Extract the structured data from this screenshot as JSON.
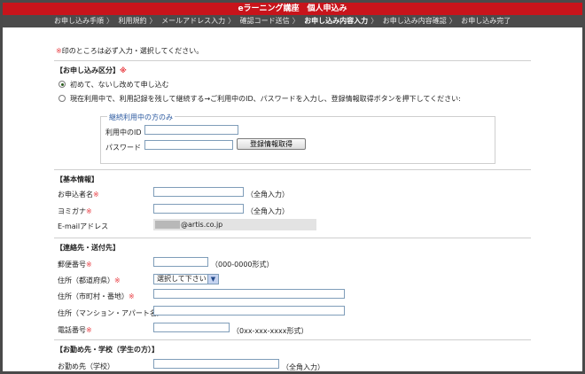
{
  "title": "eラーニング講座　個人申込み",
  "steps": [
    {
      "label": "お申し込み手順",
      "current": false
    },
    {
      "label": "利用規約",
      "current": false
    },
    {
      "label": "メールアドレス入力",
      "current": false
    },
    {
      "label": "確認コード送信",
      "current": false
    },
    {
      "label": "お申し込み内容入力",
      "current": true
    },
    {
      "label": "お申し込み内容確認",
      "current": false
    },
    {
      "label": "お申し込み完了",
      "current": false
    }
  ],
  "step_separator": "〉",
  "required_mark": "※",
  "note": "印のところは必ず入力・選択してください。",
  "application_type": {
    "heading": "【お申し込み区分】",
    "options": [
      {
        "label": "初めて、ないし改めて申し込む",
        "selected": true
      },
      {
        "label": "現在利用中で、利用記録を残して継続する→ご利用中のID、パスワードを入力し、登録情報取得ボタンを押下してください:",
        "selected": false
      }
    ],
    "continuing": {
      "legend": "継続利用中の方のみ",
      "id_label": "利用中のID",
      "password_label": "パスワード",
      "fetch_button": "登録情報取得"
    }
  },
  "basic_info": {
    "heading": "【基本情報】",
    "name_label": "お申込者名",
    "name_hint": "（全角入力）",
    "kana_label": "ヨミガナ",
    "kana_hint": "（全角入力）",
    "email_label": "E-mailアドレス",
    "email_value": "@artis.co.jp"
  },
  "contact": {
    "heading": "【連絡先・送付先】",
    "zip_label": "郵便番号",
    "zip_hint": "（000-0000形式）",
    "pref_label": "住所（都道府県）",
    "pref_value": "選択して下さい",
    "city_label": "住所（市町村・番地）",
    "building_label": "住所（マンション・アパート名）",
    "phone_label": "電話番号",
    "phone_hint": "（0xx-xxx-xxxx形式）"
  },
  "work": {
    "heading": "【お勤め先・学校（学生の方）】",
    "employer_label": "お勤め先（学校）",
    "employer_hint": "（全角入力）"
  }
}
